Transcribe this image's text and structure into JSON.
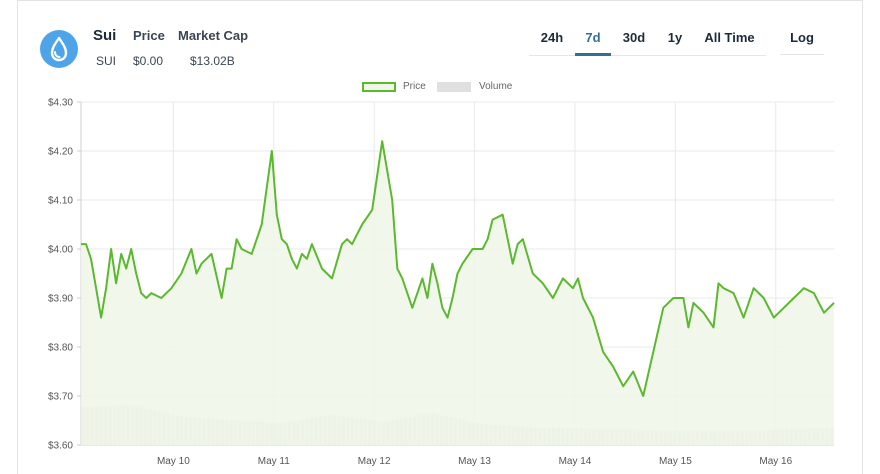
{
  "header": {
    "name": "Sui",
    "price_label": "Price",
    "market_cap_label": "Market Cap",
    "symbol": "SUI",
    "price_value": "$0.00",
    "market_cap_value": "$13.02B",
    "logo_icon": "sui-droplet-icon"
  },
  "ranges": [
    {
      "label": "24h",
      "active": false
    },
    {
      "label": "7d",
      "active": true
    },
    {
      "label": "30d",
      "active": false
    },
    {
      "label": "1y",
      "active": false
    },
    {
      "label": "All Time",
      "active": false
    }
  ],
  "log_label": "Log",
  "colors": {
    "price_line": "#5cb82e",
    "price_fill": "#eef7e8",
    "volume": "#e0e0e0",
    "active_tab": "#2f6f9a"
  },
  "chart_data": {
    "type": "area",
    "title": "",
    "legend": [
      "Price",
      "Volume"
    ],
    "legend_position": "top-center",
    "grid": true,
    "ylim": [
      3.6,
      4.3
    ],
    "y_ticks": [
      "$4.30",
      "$4.20",
      "$4.10",
      "$4.00",
      "$3.90",
      "$3.80",
      "$3.70",
      "$3.60"
    ],
    "x_ticks": [
      "May 10",
      "May 11",
      "May 12",
      "May 13",
      "May 14",
      "May 15",
      "May 16"
    ],
    "x_tick_positions_days": [
      0.92,
      1.92,
      2.92,
      3.92,
      4.92,
      5.92,
      6.92
    ],
    "xlim_days": [
      0,
      7.5
    ],
    "series": [
      {
        "name": "Price",
        "x_days": [
          0.0,
          0.05,
          0.1,
          0.15,
          0.2,
          0.25,
          0.3,
          0.35,
          0.4,
          0.45,
          0.5,
          0.55,
          0.6,
          0.65,
          0.7,
          0.8,
          0.9,
          1.0,
          1.1,
          1.15,
          1.2,
          1.3,
          1.4,
          1.45,
          1.5,
          1.55,
          1.6,
          1.7,
          1.8,
          1.9,
          1.95,
          2.0,
          2.05,
          2.1,
          2.15,
          2.2,
          2.25,
          2.3,
          2.4,
          2.5,
          2.6,
          2.65,
          2.7,
          2.8,
          2.9,
          3.0,
          3.1,
          3.15,
          3.2,
          3.3,
          3.4,
          3.45,
          3.5,
          3.55,
          3.6,
          3.65,
          3.7,
          3.75,
          3.8,
          3.9,
          4.0,
          4.05,
          4.1,
          4.2,
          4.3,
          4.35,
          4.4,
          4.5,
          4.6,
          4.7,
          4.8,
          4.9,
          4.95,
          5.0,
          5.1,
          5.2,
          5.3,
          5.4,
          5.5,
          5.6,
          5.7,
          5.8,
          5.9,
          6.0,
          6.05,
          6.1,
          6.2,
          6.3,
          6.35,
          6.4,
          6.5,
          6.6,
          6.7,
          6.8,
          6.9,
          6.95,
          7.0,
          7.1,
          7.2,
          7.3,
          7.35,
          7.4,
          7.5
        ],
        "values": [
          4.01,
          4.01,
          3.98,
          3.92,
          3.86,
          3.92,
          4.0,
          3.93,
          3.99,
          3.96,
          4.0,
          3.95,
          3.91,
          3.9,
          3.91,
          3.9,
          3.92,
          3.95,
          4.0,
          3.95,
          3.97,
          3.99,
          3.9,
          3.96,
          3.96,
          4.02,
          4.0,
          3.99,
          4.05,
          4.2,
          4.07,
          4.02,
          4.01,
          3.98,
          3.96,
          3.99,
          3.98,
          4.01,
          3.96,
          3.94,
          4.01,
          4.02,
          4.01,
          4.05,
          4.08,
          4.22,
          4.1,
          3.96,
          3.94,
          3.88,
          3.94,
          3.9,
          3.97,
          3.93,
          3.88,
          3.86,
          3.9,
          3.95,
          3.97,
          4.0,
          4.0,
          4.02,
          4.06,
          4.07,
          3.97,
          4.01,
          4.02,
          3.95,
          3.93,
          3.9,
          3.94,
          3.92,
          3.94,
          3.9,
          3.86,
          3.79,
          3.76,
          3.72,
          3.75,
          3.7,
          3.79,
          3.88,
          3.9,
          3.9,
          3.84,
          3.89,
          3.87,
          3.84,
          3.93,
          3.92,
          3.91,
          3.86,
          3.92,
          3.9,
          3.86,
          3.87,
          3.88,
          3.9,
          3.92,
          3.91,
          3.89,
          3.87,
          3.89
        ]
      },
      {
        "name": "Volume",
        "x_days": [
          0.0,
          0.5,
          1.0,
          1.5,
          2.0,
          2.5,
          3.0,
          3.5,
          4.0,
          4.5,
          5.0,
          5.5,
          6.0,
          6.5,
          7.0,
          7.5
        ],
        "values_relative": [
          0.7,
          0.72,
          0.52,
          0.45,
          0.4,
          0.55,
          0.42,
          0.58,
          0.38,
          0.32,
          0.3,
          0.28,
          0.25,
          0.25,
          0.28,
          0.32
        ]
      }
    ]
  }
}
